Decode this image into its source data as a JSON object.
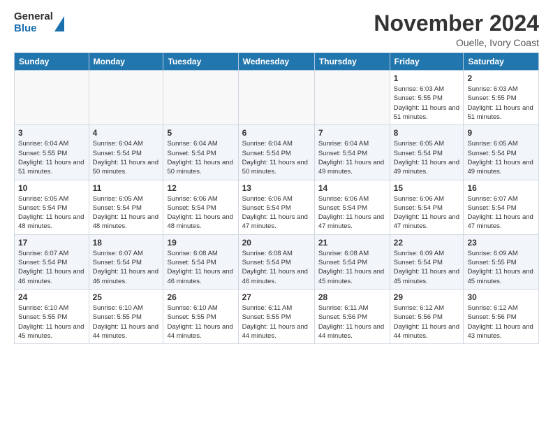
{
  "header": {
    "logo_general": "General",
    "logo_blue": "Blue",
    "title": "November 2024",
    "subtitle": "Ouelle, Ivory Coast"
  },
  "weekdays": [
    "Sunday",
    "Monday",
    "Tuesday",
    "Wednesday",
    "Thursday",
    "Friday",
    "Saturday"
  ],
  "weeks": [
    [
      {
        "day": "",
        "info": ""
      },
      {
        "day": "",
        "info": ""
      },
      {
        "day": "",
        "info": ""
      },
      {
        "day": "",
        "info": ""
      },
      {
        "day": "",
        "info": ""
      },
      {
        "day": "1",
        "info": "Sunrise: 6:03 AM\nSunset: 5:55 PM\nDaylight: 11 hours and 51 minutes."
      },
      {
        "day": "2",
        "info": "Sunrise: 6:03 AM\nSunset: 5:55 PM\nDaylight: 11 hours and 51 minutes."
      }
    ],
    [
      {
        "day": "3",
        "info": "Sunrise: 6:04 AM\nSunset: 5:55 PM\nDaylight: 11 hours and 51 minutes."
      },
      {
        "day": "4",
        "info": "Sunrise: 6:04 AM\nSunset: 5:54 PM\nDaylight: 11 hours and 50 minutes."
      },
      {
        "day": "5",
        "info": "Sunrise: 6:04 AM\nSunset: 5:54 PM\nDaylight: 11 hours and 50 minutes."
      },
      {
        "day": "6",
        "info": "Sunrise: 6:04 AM\nSunset: 5:54 PM\nDaylight: 11 hours and 50 minutes."
      },
      {
        "day": "7",
        "info": "Sunrise: 6:04 AM\nSunset: 5:54 PM\nDaylight: 11 hours and 49 minutes."
      },
      {
        "day": "8",
        "info": "Sunrise: 6:05 AM\nSunset: 5:54 PM\nDaylight: 11 hours and 49 minutes."
      },
      {
        "day": "9",
        "info": "Sunrise: 6:05 AM\nSunset: 5:54 PM\nDaylight: 11 hours and 49 minutes."
      }
    ],
    [
      {
        "day": "10",
        "info": "Sunrise: 6:05 AM\nSunset: 5:54 PM\nDaylight: 11 hours and 48 minutes."
      },
      {
        "day": "11",
        "info": "Sunrise: 6:05 AM\nSunset: 5:54 PM\nDaylight: 11 hours and 48 minutes."
      },
      {
        "day": "12",
        "info": "Sunrise: 6:06 AM\nSunset: 5:54 PM\nDaylight: 11 hours and 48 minutes."
      },
      {
        "day": "13",
        "info": "Sunrise: 6:06 AM\nSunset: 5:54 PM\nDaylight: 11 hours and 47 minutes."
      },
      {
        "day": "14",
        "info": "Sunrise: 6:06 AM\nSunset: 5:54 PM\nDaylight: 11 hours and 47 minutes."
      },
      {
        "day": "15",
        "info": "Sunrise: 6:06 AM\nSunset: 5:54 PM\nDaylight: 11 hours and 47 minutes."
      },
      {
        "day": "16",
        "info": "Sunrise: 6:07 AM\nSunset: 5:54 PM\nDaylight: 11 hours and 47 minutes."
      }
    ],
    [
      {
        "day": "17",
        "info": "Sunrise: 6:07 AM\nSunset: 5:54 PM\nDaylight: 11 hours and 46 minutes."
      },
      {
        "day": "18",
        "info": "Sunrise: 6:07 AM\nSunset: 5:54 PM\nDaylight: 11 hours and 46 minutes."
      },
      {
        "day": "19",
        "info": "Sunrise: 6:08 AM\nSunset: 5:54 PM\nDaylight: 11 hours and 46 minutes."
      },
      {
        "day": "20",
        "info": "Sunrise: 6:08 AM\nSunset: 5:54 PM\nDaylight: 11 hours and 46 minutes."
      },
      {
        "day": "21",
        "info": "Sunrise: 6:08 AM\nSunset: 5:54 PM\nDaylight: 11 hours and 45 minutes."
      },
      {
        "day": "22",
        "info": "Sunrise: 6:09 AM\nSunset: 5:54 PM\nDaylight: 11 hours and 45 minutes."
      },
      {
        "day": "23",
        "info": "Sunrise: 6:09 AM\nSunset: 5:55 PM\nDaylight: 11 hours and 45 minutes."
      }
    ],
    [
      {
        "day": "24",
        "info": "Sunrise: 6:10 AM\nSunset: 5:55 PM\nDaylight: 11 hours and 45 minutes."
      },
      {
        "day": "25",
        "info": "Sunrise: 6:10 AM\nSunset: 5:55 PM\nDaylight: 11 hours and 44 minutes."
      },
      {
        "day": "26",
        "info": "Sunrise: 6:10 AM\nSunset: 5:55 PM\nDaylight: 11 hours and 44 minutes."
      },
      {
        "day": "27",
        "info": "Sunrise: 6:11 AM\nSunset: 5:55 PM\nDaylight: 11 hours and 44 minutes."
      },
      {
        "day": "28",
        "info": "Sunrise: 6:11 AM\nSunset: 5:56 PM\nDaylight: 11 hours and 44 minutes."
      },
      {
        "day": "29",
        "info": "Sunrise: 6:12 AM\nSunset: 5:56 PM\nDaylight: 11 hours and 44 minutes."
      },
      {
        "day": "30",
        "info": "Sunrise: 6:12 AM\nSunset: 5:56 PM\nDaylight: 11 hours and 43 minutes."
      }
    ]
  ]
}
